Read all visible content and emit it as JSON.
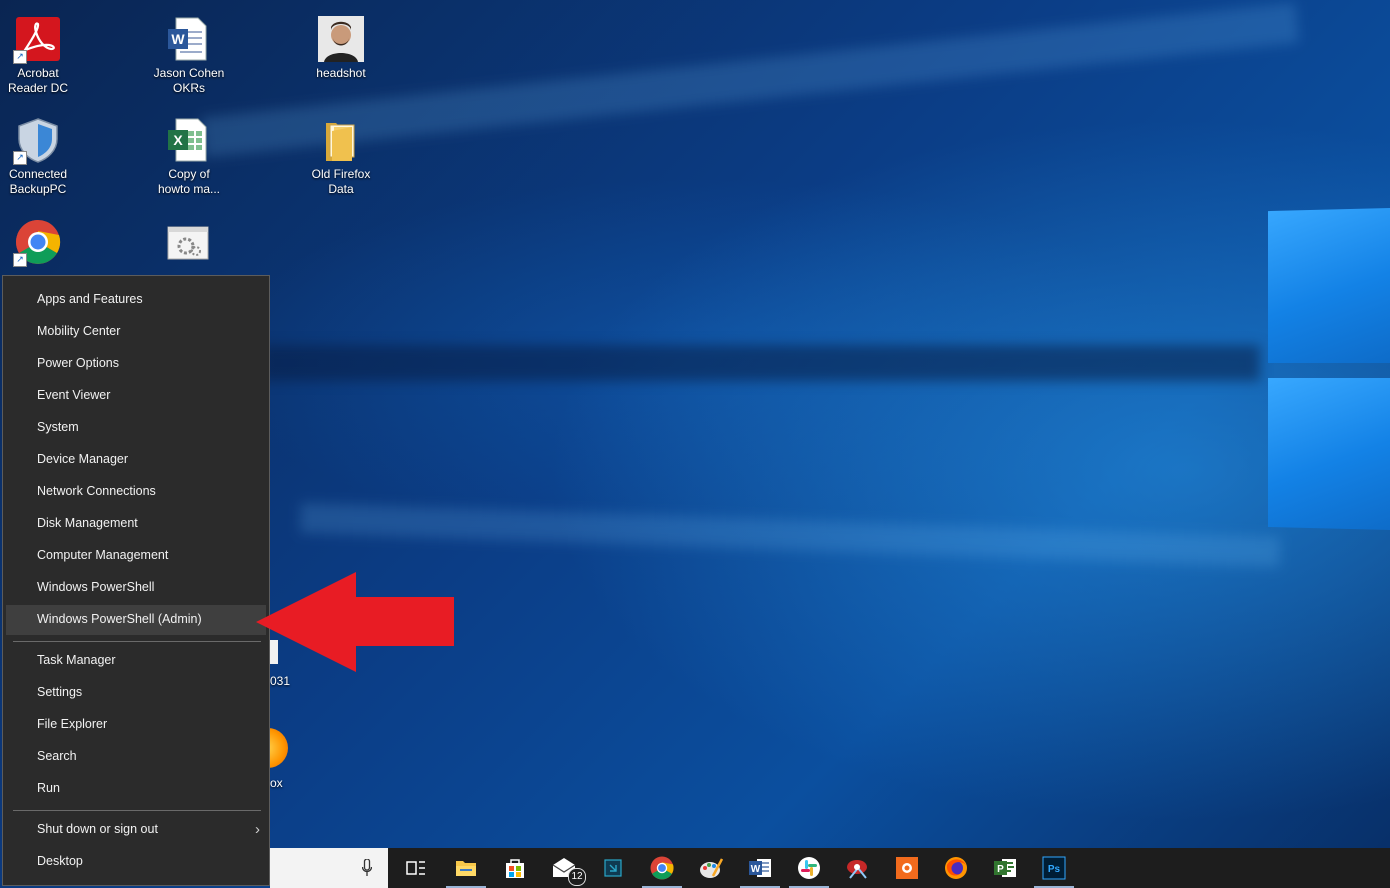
{
  "desktop": {
    "icons": [
      {
        "line1": "Acrobat",
        "line2": "Reader DC",
        "icon": "acrobat-icon"
      },
      {
        "line1": "Jason Cohen",
        "line2": "OKRs",
        "icon": "word-doc-icon"
      },
      {
        "line1": "headshot",
        "line2": "",
        "icon": "photo-icon"
      },
      {
        "line1": "Connected",
        "line2": "BackupPC",
        "icon": "shield-icon"
      },
      {
        "line1": "Copy of",
        "line2": "howto ma...",
        "icon": "excel-doc-icon"
      },
      {
        "line1": "Old Firefox",
        "line2": "Data",
        "icon": "folder-icon"
      },
      {
        "line1": "",
        "line2": "",
        "icon": "chrome-icon"
      },
      {
        "line1": "",
        "line2": "",
        "icon": "settings-file-icon"
      }
    ],
    "partial_labels": {
      "item_031": "031",
      "item_ox": "ox"
    }
  },
  "menu": {
    "items": [
      {
        "label": "Apps and Features"
      },
      {
        "label": "Mobility Center"
      },
      {
        "label": "Power Options"
      },
      {
        "label": "Event Viewer"
      },
      {
        "label": "System"
      },
      {
        "label": "Device Manager"
      },
      {
        "label": "Network Connections"
      },
      {
        "label": "Disk Management"
      },
      {
        "label": "Computer Management"
      },
      {
        "label": "Windows PowerShell"
      },
      {
        "label": "Windows PowerShell (Admin)",
        "highlighted": true
      },
      {
        "label": "Task Manager"
      },
      {
        "label": "Settings"
      },
      {
        "label": "File Explorer"
      },
      {
        "label": "Search"
      },
      {
        "label": "Run"
      },
      {
        "label": "Shut down or sign out",
        "has_submenu": true
      },
      {
        "label": "Desktop"
      }
    ]
  },
  "taskbar": {
    "apps": [
      {
        "icon": "task-view-icon"
      },
      {
        "icon": "file-explorer-icon"
      },
      {
        "icon": "store-icon"
      },
      {
        "icon": "mail-icon",
        "badge": "12"
      },
      {
        "icon": "remote-app-icon"
      },
      {
        "icon": "chrome-icon"
      },
      {
        "icon": "paint-icon"
      },
      {
        "icon": "word-icon"
      },
      {
        "icon": "slack-icon"
      },
      {
        "icon": "snip-icon"
      },
      {
        "icon": "orange-app-icon"
      },
      {
        "icon": "firefox-icon"
      },
      {
        "icon": "project-icon"
      },
      {
        "icon": "photoshop-icon"
      }
    ]
  },
  "colors": {
    "menu_bg": "#2b2b2b",
    "menu_highlight": "#3f3f3f",
    "arrow": "#e81c24",
    "taskbar_bg": "#1d1d1d",
    "desktop_accent": "#1382e6"
  }
}
